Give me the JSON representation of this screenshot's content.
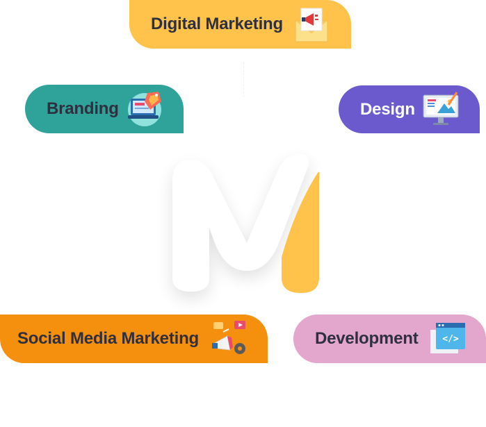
{
  "services": {
    "digital_marketing": {
      "label": "Digital Marketing",
      "icon": "megaphone-envelope-icon",
      "color": "#ffc24a"
    },
    "branding": {
      "label": "Branding",
      "icon": "laptop-tag-icon",
      "color": "#2fa39a"
    },
    "design": {
      "label": "Design",
      "icon": "design-monitor-icon",
      "color": "#6a5acd"
    },
    "social_media_marketing": {
      "label": "Social Media Marketing",
      "icon": "social-megaphone-icon",
      "color": "#f58f0e"
    },
    "development": {
      "label": "Development",
      "icon": "code-window-icon",
      "color": "#e3a6cc"
    }
  },
  "logo": {
    "icon": "m-logo-icon",
    "accent": "#ffc24a"
  }
}
